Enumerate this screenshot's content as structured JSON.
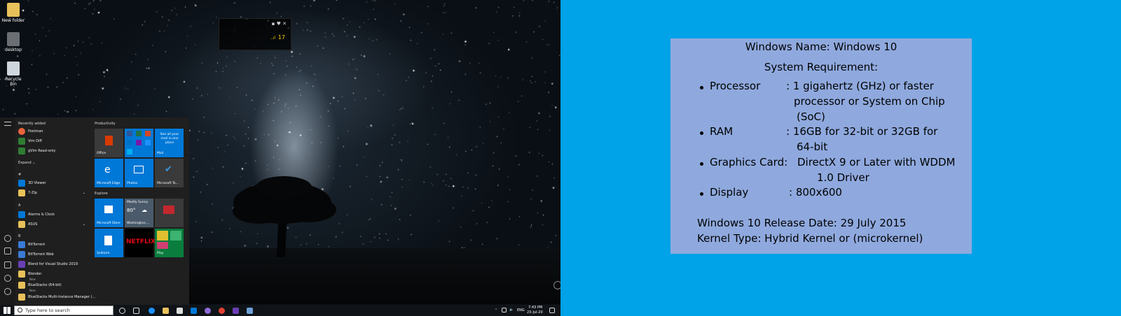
{
  "desktop": {
    "icons": [
      {
        "label": "New folder",
        "icon": "folder-icon"
      },
      {
        "label": "desktop",
        "icon": "file-icon"
      },
      {
        "label": "Recycle Bin",
        "icon": "recycle-bin-icon"
      }
    ],
    "widget": {
      "temperature": "17"
    }
  },
  "start_menu": {
    "recently_added_label": "Recently added",
    "recent_apps": [
      "Postman",
      "Vim Diff",
      "gVim Read-only"
    ],
    "expand_label": "Expand",
    "letter_numbers": "#",
    "number_apps": [
      "3D Viewer",
      "7-Zip"
    ],
    "letter_a": "A",
    "a_apps": [
      "Alarms & Clock",
      "ASUS"
    ],
    "letter_b": "B",
    "b_apps": [
      "BitTorrent",
      "BitTorrent Web",
      "Blend for Visual Studio 2019",
      "Blender",
      "BlueStacks (64-bit)",
      "BlueStacks Multi-Instance Manager (..."
    ],
    "new_badge": "New",
    "productivity_label": "Productivity",
    "explore_label": "Explore",
    "tiles": {
      "office": "Office",
      "mail_text": "See all your mail in one place",
      "mail": "Mail",
      "edge": "Microsoft Edge",
      "photos": "Photos",
      "microsoft_to": "Microsoft To...",
      "store": "Microsoft Store",
      "weather_cond": "Mostly Sunny",
      "weather_temp": "80°",
      "weather_city": "Washington,...",
      "solitaire": "Solitaire",
      "netflix": "NETFLIX",
      "play": "Play"
    }
  },
  "taskbar": {
    "search_placeholder": "Type here to search",
    "language": "ENG",
    "time": "7:43 PM",
    "date": "23-Jul-20"
  },
  "info": {
    "windows_name": "Windows Name: Windows 10",
    "system_requirement": "System Requirement:",
    "processor_label": "Processor",
    "processor_value_1": ": 1 gigahertz (GHz) or faster",
    "processor_value_2": "processor or System on Chip",
    "processor_value_3": "(SoC)",
    "ram_label": "RAM",
    "ram_value_1": ": 16GB for 32-bit or 32GB for",
    "ram_value_2": "64-bit",
    "graphics_label": "Graphics Card:",
    "graphics_value_1": "DirectX 9 or Later with WDDM",
    "graphics_value_2": "1.0 Driver",
    "display_label": "Display",
    "display_value": ": 800x600",
    "release_date": "Windows 10 Release Date: 29 July 2015",
    "kernel_type": "Kernel Type: Hybrid Kernel or (microkernel)"
  },
  "colors": {
    "right_background": "#00a2e8",
    "info_box": "#8fa9de",
    "start_menu": "#1f1f1f",
    "tile_blue": "#0078d7"
  }
}
